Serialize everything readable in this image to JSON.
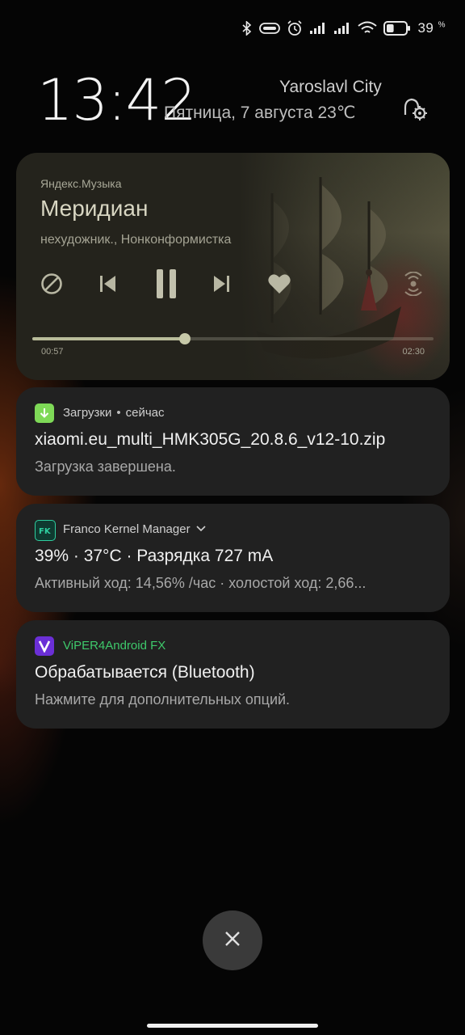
{
  "status_bar": {
    "battery_percent": "39",
    "battery_percent_symbol": "%",
    "battery_level": 0.39,
    "icons": [
      "bluetooth-icon",
      "vpn-key-icon",
      "alarm-icon",
      "signal-icon",
      "signal-icon",
      "wifi-icon",
      "battery-icon"
    ]
  },
  "header": {
    "time": "13:42",
    "city": "Yaroslavl City",
    "date_weather": "Пятница, 7 августа  23℃"
  },
  "music": {
    "source": "Яндекс.Музыка",
    "title": "Меридиан",
    "artist": "нехудожник., Нонконформистка",
    "elapsed": "00:57",
    "total": "02:30",
    "progress": 0.38,
    "controls": [
      "block-icon",
      "previous-icon",
      "pause-icon",
      "next-icon",
      "heart-icon",
      "cast-icon"
    ],
    "accent_color": "#b9bc9a"
  },
  "notifications": [
    {
      "app": "Загрузки",
      "separator": "•",
      "time": "сейчас",
      "title": "xiaomi.eu_multi_HMK305G_20.8.6_v12-10.zip",
      "text": "Загрузка завершена.",
      "icon_color": "#7ed957"
    },
    {
      "app": "Franco Kernel Manager",
      "title": "39% · 37°C · Разрядка 727 mA",
      "text": "Активный ход: 14,56% /час · холостой ход: 2,66...",
      "icon_color": "#2ecfa0"
    },
    {
      "app": "ViPER4Android FX",
      "title": "Обрабатывается (Bluetooth)",
      "text": "Нажмите для дополнительных опций.",
      "icon_color": "#6b2fd6",
      "app_color": "#3ec96b"
    }
  ]
}
